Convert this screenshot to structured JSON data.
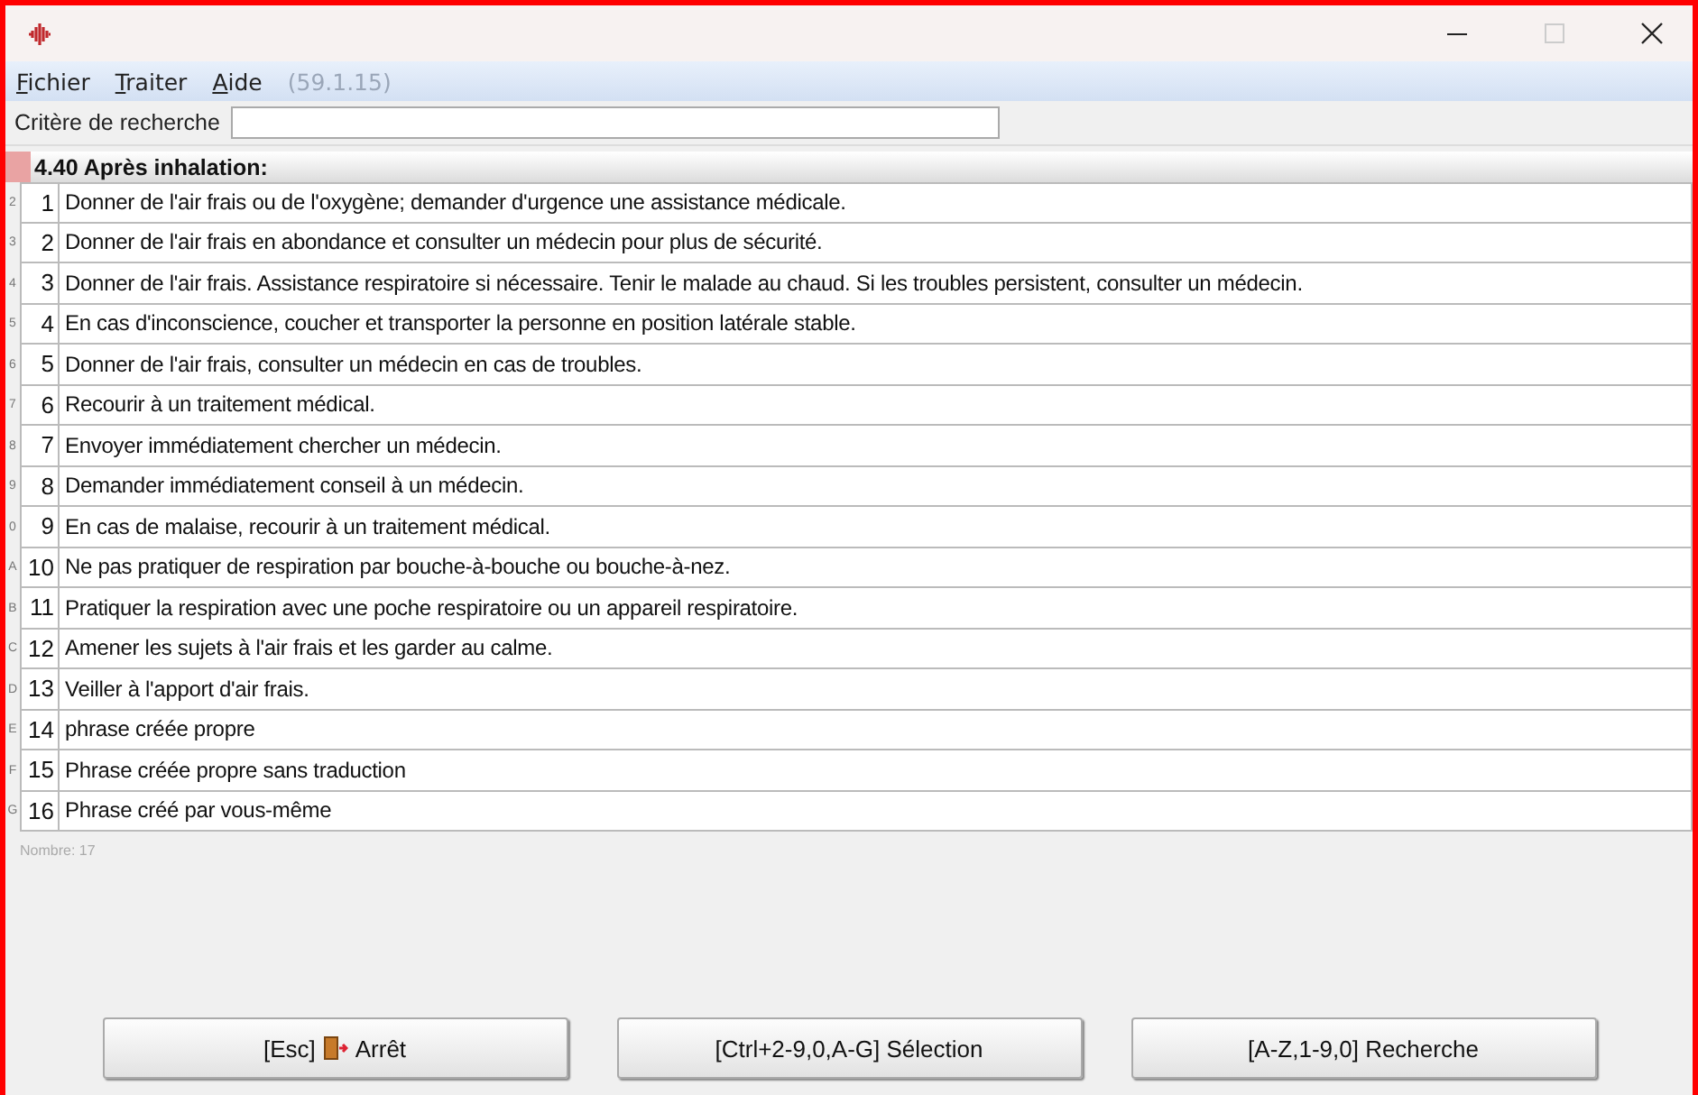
{
  "menu": [
    {
      "label": "Fichier"
    },
    {
      "label": "Traiter"
    },
    {
      "label": "Aide"
    }
  ],
  "version": "(59.1.15)",
  "search": {
    "label": "Critère de recherche"
  },
  "section": "4.40 Après inhalation:",
  "rows": [
    {
      "key": "2",
      "num": "1",
      "text": "Donner de l'air frais ou de l'oxygène; demander d'urgence une assistance médicale."
    },
    {
      "key": "3",
      "num": "2",
      "text": "Donner de l'air frais en abondance et consulter un médecin pour plus de sécurité."
    },
    {
      "key": "4",
      "num": "3",
      "text": "Donner de l'air frais. Assistance respiratoire si nécessaire. Tenir le malade au chaud. Si les troubles persistent, consulter un médecin."
    },
    {
      "key": "5",
      "num": "4",
      "text": "En cas d'inconscience, coucher et transporter la personne en position latérale stable."
    },
    {
      "key": "6",
      "num": "5",
      "text": "Donner de l'air frais, consulter un médecin en cas de troubles."
    },
    {
      "key": "7",
      "num": "6",
      "text": "Recourir à un traitement médical."
    },
    {
      "key": "8",
      "num": "7",
      "text": "Envoyer immédiatement chercher un médecin."
    },
    {
      "key": "9",
      "num": "8",
      "text": "Demander immédiatement conseil à un médecin."
    },
    {
      "key": "0",
      "num": "9",
      "text": "En cas de malaise, recourir à un traitement médical."
    },
    {
      "key": "A",
      "num": "10",
      "text": "Ne pas pratiquer de respiration par bouche-à-bouche ou bouche-à-nez."
    },
    {
      "key": "B",
      "num": "11",
      "text": "Pratiquer la respiration avec une poche respiratoire ou un appareil respiratoire."
    },
    {
      "key": "C",
      "num": "12",
      "text": "Amener les sujets à l'air frais et les garder au calme."
    },
    {
      "key": "D",
      "num": "13",
      "text": "Veiller à l'apport d'air frais."
    },
    {
      "key": "E",
      "num": "14",
      "text": "phrase créée propre"
    },
    {
      "key": "F",
      "num": "15",
      "text": "Phrase créée propre sans traduction"
    },
    {
      "key": "G",
      "num": "16",
      "text": "Phrase créé par vous-même"
    }
  ],
  "count": "Nombre: 17",
  "buttons": [
    {
      "kind": "exit",
      "before": "[Esc]",
      "after": "Arrêt"
    },
    {
      "kind": "plain",
      "label": "[Ctrl+2-9,0,A-G] Sélection"
    },
    {
      "kind": "plain",
      "label": "[A-Z,1-9,0] Recherche"
    }
  ]
}
